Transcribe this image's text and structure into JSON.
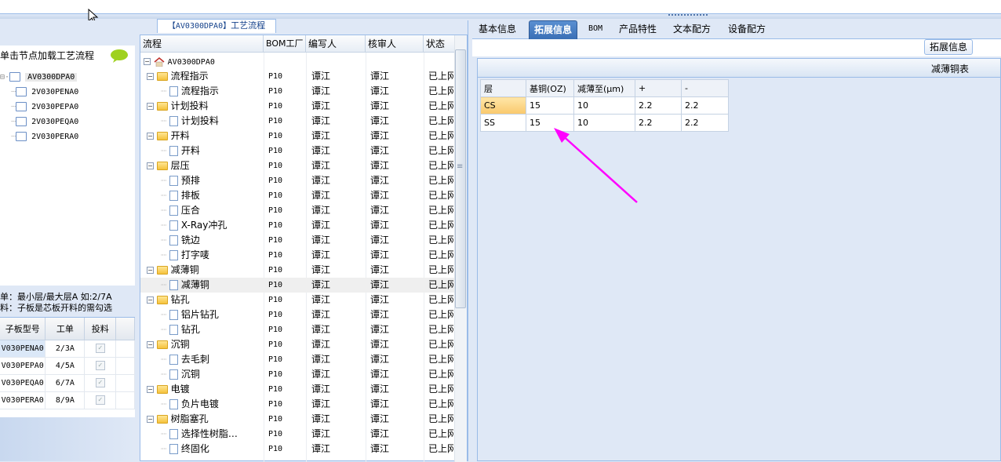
{
  "left": {
    "hint": "单击节点加载工艺流程",
    "tree": [
      "AV0300DPA0",
      "2V030PENA0",
      "2V030PEPA0",
      "2V030PEQA0",
      "2V030PERA0"
    ],
    "note1": "单：最小层/最大层A 如:2/7A",
    "note2": "料：子板是芯板开料的需勾选",
    "grid": {
      "headers": [
        "子板型号",
        "工单",
        "投料"
      ],
      "rows": [
        {
          "model": "V030PENA0",
          "order": "2/3A",
          "check": "✓"
        },
        {
          "model": "V030PEPA0",
          "order": "4/5A",
          "check": "✓"
        },
        {
          "model": "V030PEQA0",
          "order": "6/7A",
          "check": "✓"
        },
        {
          "model": "V030PERA0",
          "order": "8/9A",
          "check": "✓"
        }
      ]
    }
  },
  "middle": {
    "title_code": "【AV0300DPA0】",
    "title": "工艺流程",
    "headers": [
      "流程",
      "BOM工厂",
      "编写人",
      "核审人",
      "状态"
    ],
    "root": "AV0300DPA0",
    "rows": [
      {
        "name": "流程指示",
        "type": "folder",
        "bom": "P10",
        "writer": "谭江",
        "reviewer": "谭江",
        "status": "已上网"
      },
      {
        "name": "流程指示",
        "type": "doc",
        "bom": "P10",
        "writer": "谭江",
        "reviewer": "谭江",
        "status": "已上网"
      },
      {
        "name": "计划投料",
        "type": "folder",
        "bom": "P10",
        "writer": "谭江",
        "reviewer": "谭江",
        "status": "已上网"
      },
      {
        "name": "计划投料",
        "type": "doc",
        "bom": "P10",
        "writer": "谭江",
        "reviewer": "谭江",
        "status": "已上网"
      },
      {
        "name": "开料",
        "type": "folder",
        "bom": "P10",
        "writer": "谭江",
        "reviewer": "谭江",
        "status": "已上网"
      },
      {
        "name": "开料",
        "type": "doc",
        "bom": "P10",
        "writer": "谭江",
        "reviewer": "谭江",
        "status": "已上网"
      },
      {
        "name": "层压",
        "type": "folder",
        "bom": "P10",
        "writer": "谭江",
        "reviewer": "谭江",
        "status": "已上网"
      },
      {
        "name": "预排",
        "type": "doc",
        "bom": "P10",
        "writer": "谭江",
        "reviewer": "谭江",
        "status": "已上网"
      },
      {
        "name": "排板",
        "type": "doc",
        "bom": "P10",
        "writer": "谭江",
        "reviewer": "谭江",
        "status": "已上网"
      },
      {
        "name": "压合",
        "type": "doc",
        "bom": "P10",
        "writer": "谭江",
        "reviewer": "谭江",
        "status": "已上网"
      },
      {
        "name": "X-Ray冲孔",
        "type": "doc",
        "bom": "P10",
        "writer": "谭江",
        "reviewer": "谭江",
        "status": "已上网"
      },
      {
        "name": "铣边",
        "type": "doc",
        "bom": "P10",
        "writer": "谭江",
        "reviewer": "谭江",
        "status": "已上网"
      },
      {
        "name": "打字唛",
        "type": "doc",
        "bom": "P10",
        "writer": "谭江",
        "reviewer": "谭江",
        "status": "已上网"
      },
      {
        "name": "减薄铜",
        "type": "folder",
        "bom": "P10",
        "writer": "谭江",
        "reviewer": "谭江",
        "status": "已上网"
      },
      {
        "name": "减薄铜",
        "type": "doc",
        "bom": "P10",
        "writer": "谭江",
        "reviewer": "谭江",
        "status": "已上网"
      },
      {
        "name": "钻孔",
        "type": "folder",
        "bom": "P10",
        "writer": "谭江",
        "reviewer": "谭江",
        "status": "已上网"
      },
      {
        "name": "铝片钻孔",
        "type": "doc",
        "bom": "P10",
        "writer": "谭江",
        "reviewer": "谭江",
        "status": "已上网"
      },
      {
        "name": "钻孔",
        "type": "doc",
        "bom": "P10",
        "writer": "谭江",
        "reviewer": "谭江",
        "status": "已上网"
      },
      {
        "name": "沉铜",
        "type": "folder",
        "bom": "P10",
        "writer": "谭江",
        "reviewer": "谭江",
        "status": "已上网"
      },
      {
        "name": "去毛刺",
        "type": "doc",
        "bom": "P10",
        "writer": "谭江",
        "reviewer": "谭江",
        "status": "已上网"
      },
      {
        "name": "沉铜",
        "type": "doc",
        "bom": "P10",
        "writer": "谭江",
        "reviewer": "谭江",
        "status": "已上网"
      },
      {
        "name": "电镀",
        "type": "folder",
        "bom": "P10",
        "writer": "谭江",
        "reviewer": "谭江",
        "status": "已上网"
      },
      {
        "name": "负片电镀",
        "type": "doc",
        "bom": "P10",
        "writer": "谭江",
        "reviewer": "谭江",
        "status": "已上网"
      },
      {
        "name": "树脂塞孔",
        "type": "folder",
        "bom": "P10",
        "writer": "谭江",
        "reviewer": "谭江",
        "status": "已上网"
      },
      {
        "name": "选择性树脂…",
        "type": "doc",
        "bom": "P10",
        "writer": "谭江",
        "reviewer": "谭江",
        "status": "已上网"
      },
      {
        "name": "终固化",
        "type": "doc",
        "bom": "P10",
        "writer": "谭江",
        "reviewer": "谭江",
        "status": "已上网"
      }
    ]
  },
  "right": {
    "tabs": [
      "基本信息",
      "拓展信息",
      "BOM",
      "产品特性",
      "文本配方",
      "设备配方"
    ],
    "subtab": "拓展信息",
    "table_title": "减薄铜表",
    "grid": {
      "headers": [
        "层",
        "基铜(OZ)",
        "减薄至(μm)",
        "+",
        "-"
      ],
      "rows": [
        [
          "CS",
          "15",
          "10",
          "2.2",
          "2.2"
        ],
        [
          "SS",
          "15",
          "10",
          "2.2",
          "2.2"
        ]
      ]
    },
    "arrow_color": "#ff00ff"
  }
}
